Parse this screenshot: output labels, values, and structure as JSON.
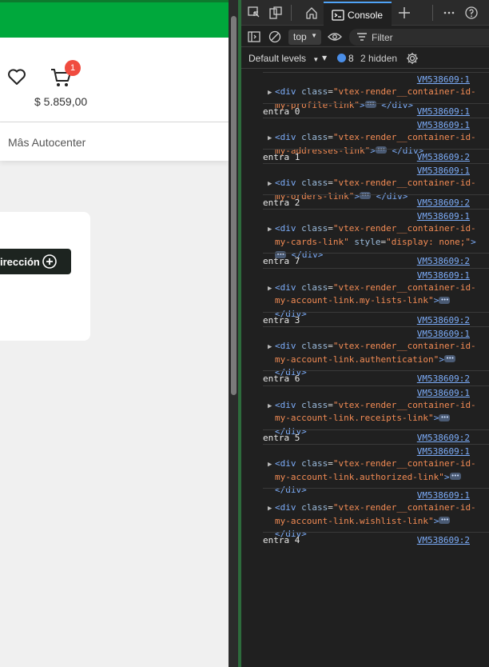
{
  "page": {
    "cart_badge": "1",
    "cart_price": "$ 5.859,00",
    "nav_link": "Mâs Autocenter",
    "address_button": "irección"
  },
  "devtools": {
    "active_tab": "Console",
    "context": "top",
    "filter_placeholder": "Filter",
    "levels": "Default levels",
    "message_count": "8",
    "hidden_count": "2 hidden",
    "entries": [
      {
        "kind": "el",
        "src": "VM538609:1",
        "line1": "my-profile-link",
        "tail": "",
        "lines": 2
      },
      {
        "kind": "text",
        "src": "VM538609:1",
        "text": "entra 0"
      },
      {
        "kind": "el",
        "src": "VM538609:1",
        "line1": "my-addresses-link",
        "lines": 2
      },
      {
        "kind": "text",
        "src": "VM538609:2",
        "text": "entra 1"
      },
      {
        "kind": "el",
        "src": "VM538609:1",
        "line1": "my-orders-link",
        "lines": 2
      },
      {
        "kind": "text",
        "src": "VM538609:2",
        "text": "entra 2"
      },
      {
        "kind": "el",
        "src": "VM538609:1",
        "line1": "my-cards-link",
        "lines": 3
      },
      {
        "kind": "text",
        "src": "VM538609:2",
        "text": "entra 7"
      },
      {
        "kind": "el",
        "src": "VM538609:1",
        "line1": "my-account-link.my-lists-link",
        "lines": 3
      },
      {
        "kind": "text",
        "src": "VM538609:2",
        "text": "entra 3"
      },
      {
        "kind": "el",
        "src": "VM538609:1",
        "line1": "my-account-link.authentication",
        "lines": 3
      },
      {
        "kind": "text",
        "src": "VM538609:2",
        "text": "entra 6"
      },
      {
        "kind": "el",
        "src": "VM538609:1",
        "line1": "my-account-link.receipts-link",
        "lines": 3
      },
      {
        "kind": "text",
        "src": "VM538609:2",
        "text": "entra 5"
      },
      {
        "kind": "el",
        "src": "VM538609:1",
        "line1": "my-account-link.authorized-link",
        "lines": 3
      },
      {
        "kind": "el",
        "src": "VM538609:1",
        "line1": "my-account-link.wishlist-link",
        "lines": 3
      },
      {
        "kind": "text",
        "src": "VM538609:2",
        "text": "entra 4"
      }
    ],
    "code": {
      "open": "<div",
      "class_attr": "class",
      "class_prefix": "\"vtex-render__container-id-",
      "style_attr": "style",
      "style_val": "\"display: none;\"",
      "close_tag": "</div>",
      "gt": ">"
    }
  }
}
